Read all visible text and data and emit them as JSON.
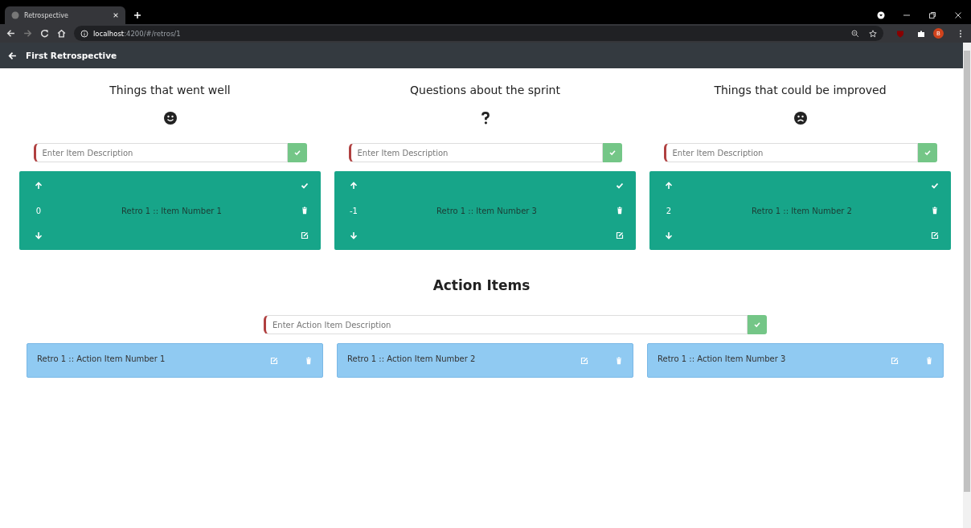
{
  "browser": {
    "tab_title": "Retrospective",
    "url_host": "localhost",
    "url_path": ":4200/#/retros/1",
    "profile_initial": "B"
  },
  "header": {
    "title": "First Retrospective"
  },
  "columns": [
    {
      "title": "Things that went well",
      "kind": "smile",
      "placeholder": "Enter Item Description",
      "items": [
        {
          "votes": "0",
          "text": "Retro 1 :: Item Number 1"
        }
      ]
    },
    {
      "title": "Questions about the sprint",
      "kind": "question",
      "placeholder": "Enter Item Description",
      "items": [
        {
          "votes": "-1",
          "text": "Retro 1 :: Item Number 3"
        }
      ]
    },
    {
      "title": "Things that could be improved",
      "kind": "frown",
      "placeholder": "Enter Item Description",
      "items": [
        {
          "votes": "2",
          "text": "Retro 1 :: Item Number 2"
        }
      ]
    }
  ],
  "action_items": {
    "title": "Action Items",
    "placeholder": "Enter Action Item Description",
    "items": [
      {
        "text": "Retro 1 :: Action Item Number 1"
      },
      {
        "text": "Retro 1 :: Action Item Number 2"
      },
      {
        "text": "Retro 1 :: Action Item Number 3"
      }
    ]
  }
}
